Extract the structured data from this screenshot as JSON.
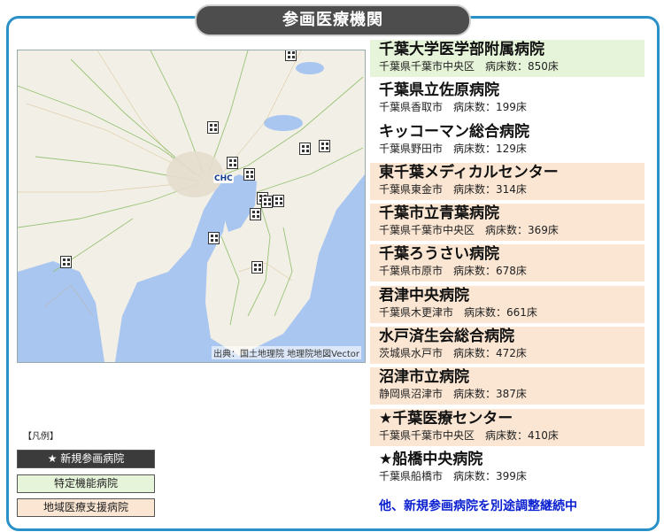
{
  "title": "参画医療機関",
  "map": {
    "credit": "出典：国土地理院 地理院地図Vector",
    "logo_text": "CHC",
    "colors": {
      "sea": "#a9c6f0",
      "land": "#f2efe6",
      "road": "#8fbf6a"
    }
  },
  "legend": {
    "title": "【凡例】",
    "new": "★ 新規参画病院",
    "special": "特定機能病院",
    "regional": "地域医療支援病院"
  },
  "hospitals": [
    {
      "name": "千葉大学医学部附属病院",
      "location": "千葉県千葉市中央区",
      "beds_label": "病床数：850床",
      "category": "special"
    },
    {
      "name": "千葉県立佐原病院",
      "location": "千葉県香取市",
      "beds_label": "病床数：199床",
      "category": "none"
    },
    {
      "name": "キッコーマン総合病院",
      "location": "千葉県野田市",
      "beds_label": "病床数：129床",
      "category": "none"
    },
    {
      "name": "東千葉メディカルセンター",
      "location": "千葉県東金市",
      "beds_label": "病床数：314床",
      "category": "regional"
    },
    {
      "name": "千葉市立青葉病院",
      "location": "千葉県千葉市中央区",
      "beds_label": "病床数：369床",
      "category": "regional"
    },
    {
      "name": "千葉ろうさい病院",
      "location": "千葉県市原市",
      "beds_label": "病床数：678床",
      "category": "regional"
    },
    {
      "name": "君津中央病院",
      "location": "千葉県木更津市",
      "beds_label": "病床数：661床",
      "category": "regional"
    },
    {
      "name": "水戸済生会総合病院",
      "location": "茨城県水戸市",
      "beds_label": "病床数：472床",
      "category": "regional"
    },
    {
      "name": "沼津市立病院",
      "location": "静岡県沼津市",
      "beds_label": "病床数：387床",
      "category": "regional"
    },
    {
      "name": "★千葉医療センター",
      "location": "千葉県千葉市中央区",
      "beds_label": "病床数：410床",
      "category": "regional"
    },
    {
      "name": "★船橋中央病院",
      "location": "千葉県船橋市",
      "beds_label": "病床数：399床",
      "category": "none"
    }
  ],
  "footer_note": "他、新規参画病院を別途調整継続中"
}
